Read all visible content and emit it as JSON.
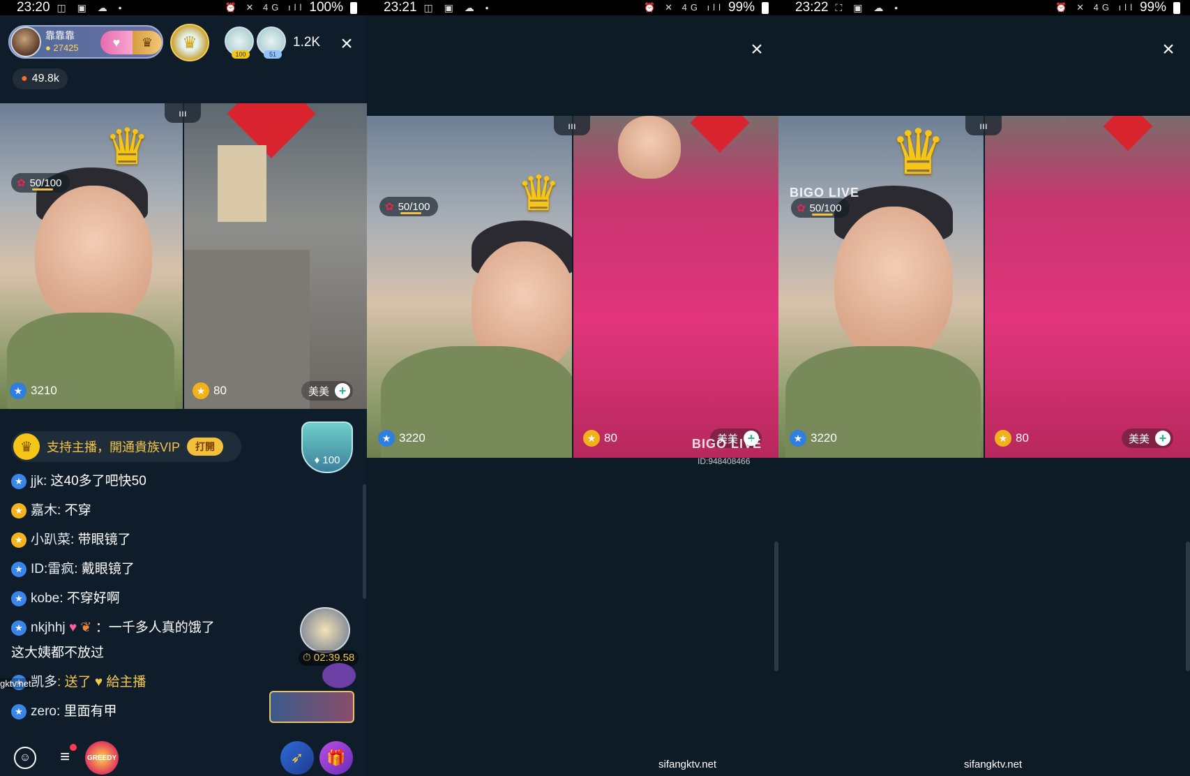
{
  "panel1": {
    "status": {
      "time": "23:20",
      "battery": "100%"
    },
    "host": {
      "name": "靠靠靠",
      "coins": "27425"
    },
    "viewers": [
      {
        "badge": "100"
      },
      {
        "badge": "51"
      }
    ],
    "viewer_count": "1.2K",
    "heat": "49.8k",
    "rose_progress": "50/100",
    "left_score": "3210",
    "right_score": "80",
    "right_name": "美美",
    "vip": {
      "text": "支持主播，開通貴族VIP",
      "button": "打開"
    },
    "gift_shield_value": "100",
    "chat": [
      {
        "badge": "blue",
        "user": "jjk",
        "text": ": 这40多了吧快50"
      },
      {
        "badge": "yellow",
        "user": "嘉木",
        "text": ": 不穿"
      },
      {
        "badge": "yellow",
        "user": "小趴菜",
        "text": ": 带眼镜了"
      },
      {
        "badge": "blue",
        "user": "ID:雷疯",
        "text": ": 戴眼镜了"
      },
      {
        "badge": "blue",
        "user": "kobe",
        "text": ": 不穿好啊"
      },
      {
        "badge": "blue",
        "user": "nkjhhj",
        "text": "：一千多人真的饿了",
        "line2": "这大姨都不放过"
      },
      {
        "badge": "blue",
        "user": "凯多",
        "gift": ": 送了 ♥ 給主播"
      },
      {
        "badge": "blue",
        "user": "zero",
        "text": ": 里面有甲"
      }
    ],
    "timer": "02:39.58",
    "watermark": "gktv.net",
    "greedy_label": "GREEDY"
  },
  "panel2": {
    "status": {
      "time": "23:21",
      "battery": "99%"
    },
    "rose_progress": "50/100",
    "left_score": "3220",
    "right_score": "80",
    "right_name": "美美",
    "bigo": "BIGO LIVE",
    "bigo_id": "ID:948408466",
    "site": "sifangktv.net"
  },
  "panel3": {
    "status": {
      "time": "23:22",
      "battery": "99%"
    },
    "rose_progress": "50/100",
    "left_score": "3220",
    "right_score": "80",
    "right_name": "美美",
    "bigo": "BIGO LIVE",
    "site": "sifangktv.net"
  },
  "icons": {
    "close": "×",
    "star": "★",
    "rose": "✿",
    "flame": "🔥",
    "plus": "+",
    "crown": "♛",
    "menu": "≡",
    "chat": "☺",
    "gift": "🎁",
    "rocket": "➶",
    "pk": "ııı"
  }
}
